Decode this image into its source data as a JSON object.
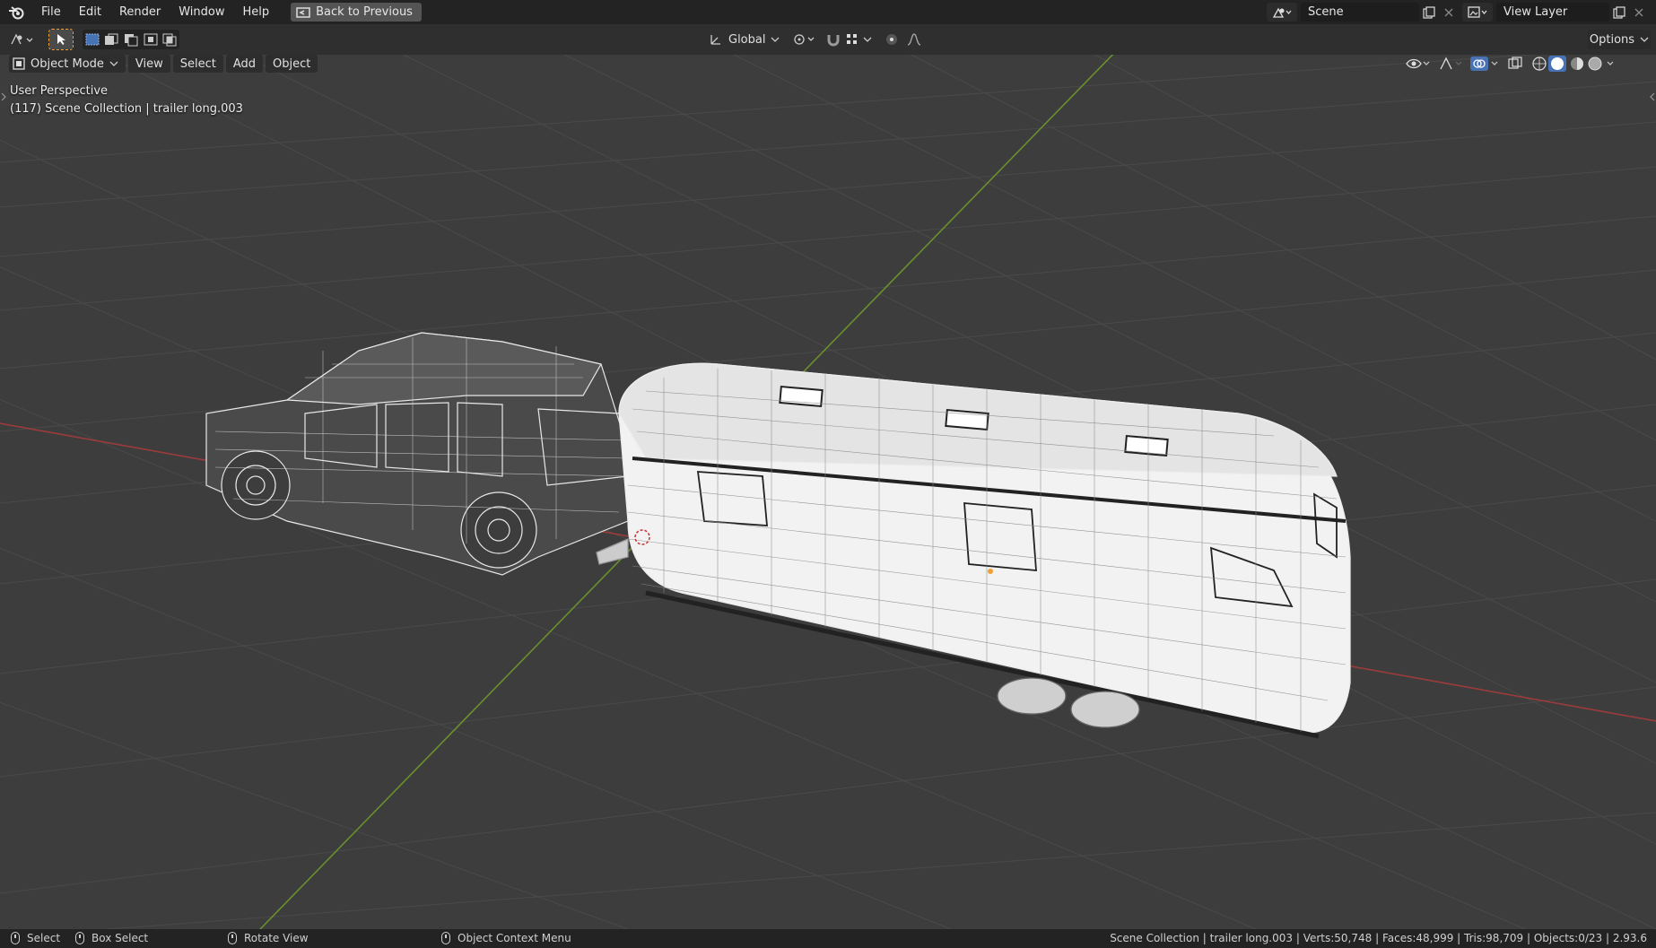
{
  "menubar": {
    "items": [
      "File",
      "Edit",
      "Render",
      "Window",
      "Help"
    ],
    "back_label": "Back to Previous",
    "scene_value": "Scene",
    "view_layer_value": "View Layer"
  },
  "toolheader": {
    "orientation": "Global",
    "options_label": "Options"
  },
  "viewport_header": {
    "mode": "Object Mode",
    "menus": [
      "View",
      "Select",
      "Add",
      "Object"
    ]
  },
  "viewport": {
    "perspective": "User Perspective",
    "collection_info": "(117) Scene Collection | trailer long.003"
  },
  "statusbar": {
    "select": "Select",
    "box_select": "Box Select",
    "rotate_view": "Rotate View",
    "context_menu": "Object Context Menu",
    "stats": "Scene Collection | trailer long.003 | Verts:50,748 | Faces:48,999 | Tris:98,709 | Objects:0/23 | 2.93.6"
  },
  "colors": {
    "accent_blue": "#4772b3",
    "x_axis": "#9c3b3b",
    "y_axis": "#6a8f2f",
    "grid": "#4a4a4a",
    "origin": "#f0a030"
  }
}
